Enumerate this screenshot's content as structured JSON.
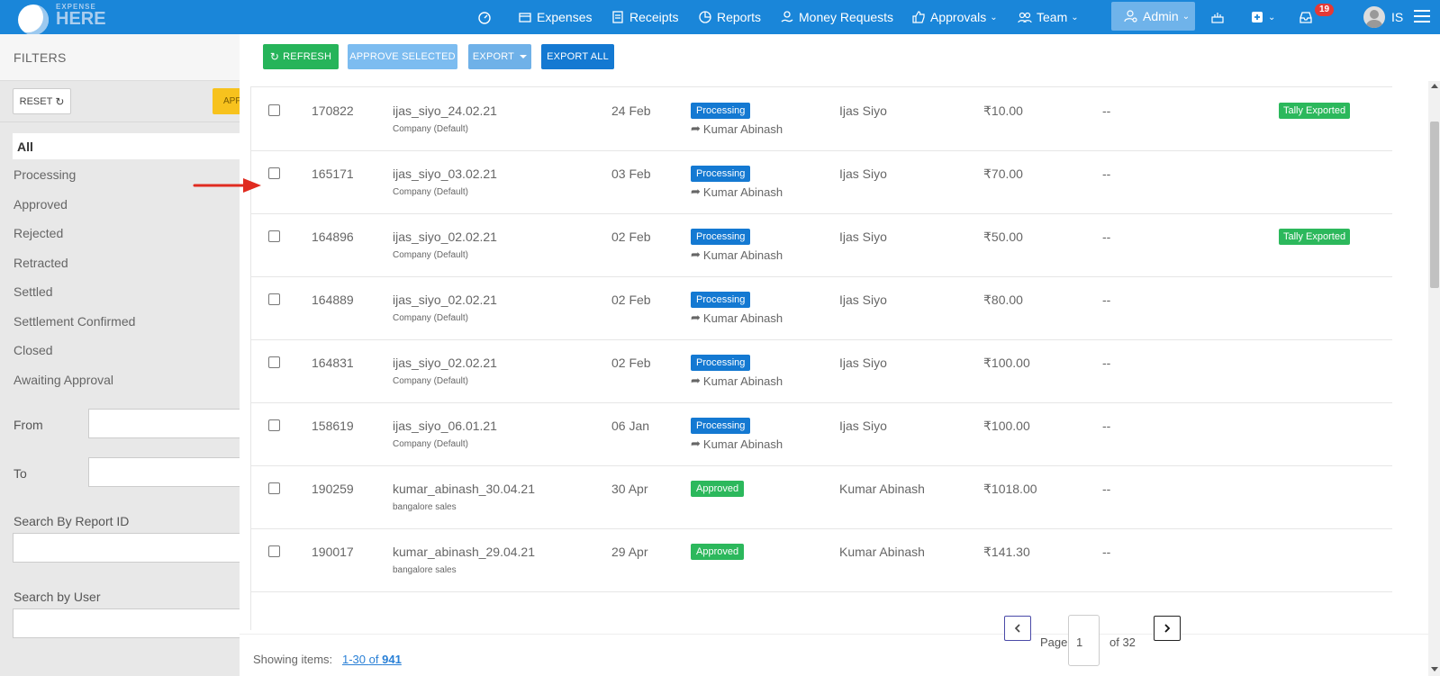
{
  "brand": {
    "logo_small": "EXPENSE",
    "logo_main": "HERE",
    "primary_color": "#1a86d9"
  },
  "nav": {
    "expenses": "Expenses",
    "receipts": "Receipts",
    "reports": "Reports",
    "money_requests": "Money Requests",
    "approvals": "Approvals",
    "team": "Team",
    "admin": "Admin",
    "inbox_count": "19",
    "user_initials": "IS"
  },
  "sidebar": {
    "title": "FILTERS",
    "reset_label": "RESET",
    "apply_label": "APP",
    "statuses": [
      "All",
      "Processing",
      "Approved",
      "Rejected",
      "Retracted",
      "Settled",
      "Settlement Confirmed",
      "Closed",
      "Awaiting Approval"
    ],
    "from_label": "From",
    "to_label": "To",
    "search_report_label": "Search By Report ID",
    "search_user_label": "Search by User"
  },
  "toolbar": {
    "refresh": "REFRESH",
    "approve_selected": "APPROVE SELECTED",
    "export": "EXPORT",
    "export_all": "EXPORT ALL"
  },
  "rows": [
    {
      "id": "170822",
      "name": "ijas_siyo_24.02.21",
      "sub": "Company (Default)",
      "date": "24 Feb",
      "status": "Processing",
      "forward": "Kumar Abinash",
      "user": "Ijas Siyo",
      "amount": "₹10.00",
      "dash": "--",
      "tally": "Tally Exported"
    },
    {
      "id": "165171",
      "name": "ijas_siyo_03.02.21",
      "sub": "Company (Default)",
      "date": "03 Feb",
      "status": "Processing",
      "forward": "Kumar Abinash",
      "user": "Ijas Siyo",
      "amount": "₹70.00",
      "dash": "--",
      "tally": ""
    },
    {
      "id": "164896",
      "name": "ijas_siyo_02.02.21",
      "sub": "Company (Default)",
      "date": "02 Feb",
      "status": "Processing",
      "forward": "Kumar Abinash",
      "user": "Ijas Siyo",
      "amount": "₹50.00",
      "dash": "--",
      "tally": "Tally Exported"
    },
    {
      "id": "164889",
      "name": "ijas_siyo_02.02.21",
      "sub": "Company (Default)",
      "date": "02 Feb",
      "status": "Processing",
      "forward": "Kumar Abinash",
      "user": "Ijas Siyo",
      "amount": "₹80.00",
      "dash": "--",
      "tally": ""
    },
    {
      "id": "164831",
      "name": "ijas_siyo_02.02.21",
      "sub": "Company (Default)",
      "date": "02 Feb",
      "status": "Processing",
      "forward": "Kumar Abinash",
      "user": "Ijas Siyo",
      "amount": "₹100.00",
      "dash": "--",
      "tally": ""
    },
    {
      "id": "158619",
      "name": "ijas_siyo_06.01.21",
      "sub": "Company (Default)",
      "date": "06 Jan",
      "status": "Processing",
      "forward": "Kumar Abinash",
      "user": "Ijas Siyo",
      "amount": "₹100.00",
      "dash": "--",
      "tally": ""
    },
    {
      "id": "190259",
      "name": "kumar_abinash_30.04.21",
      "sub": "bangalore sales",
      "date": "30 Apr",
      "status": "Approved",
      "forward": "",
      "user": "Kumar Abinash",
      "amount": "₹1018.00",
      "dash": "--",
      "tally": ""
    },
    {
      "id": "190017",
      "name": "kumar_abinash_29.04.21",
      "sub": "bangalore sales",
      "date": "29 Apr",
      "status": "Approved",
      "forward": "",
      "user": "Kumar Abinash",
      "amount": "₹141.30",
      "dash": "--",
      "tally": ""
    }
  ],
  "footer": {
    "showing_label": "Showing items:",
    "range_a": "1-30",
    "range_of": "of",
    "range_total": "941",
    "page_label": "Page",
    "page_value": "1",
    "of_pages": "of 32"
  }
}
